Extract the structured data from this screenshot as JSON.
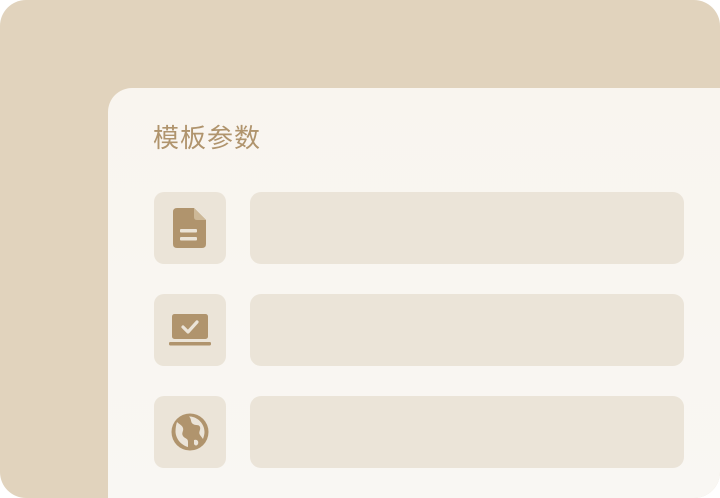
{
  "panel": {
    "title": "模板参数"
  },
  "rows": [
    {
      "icon": "document-icon",
      "value": ""
    },
    {
      "icon": "laptop-check-icon",
      "value": ""
    },
    {
      "icon": "globe-icon",
      "value": ""
    }
  ],
  "colors": {
    "background": "#e1d3bd",
    "panel": "#f9f6f1",
    "tile": "#ebe4d8",
    "accent": "#b0946d"
  }
}
